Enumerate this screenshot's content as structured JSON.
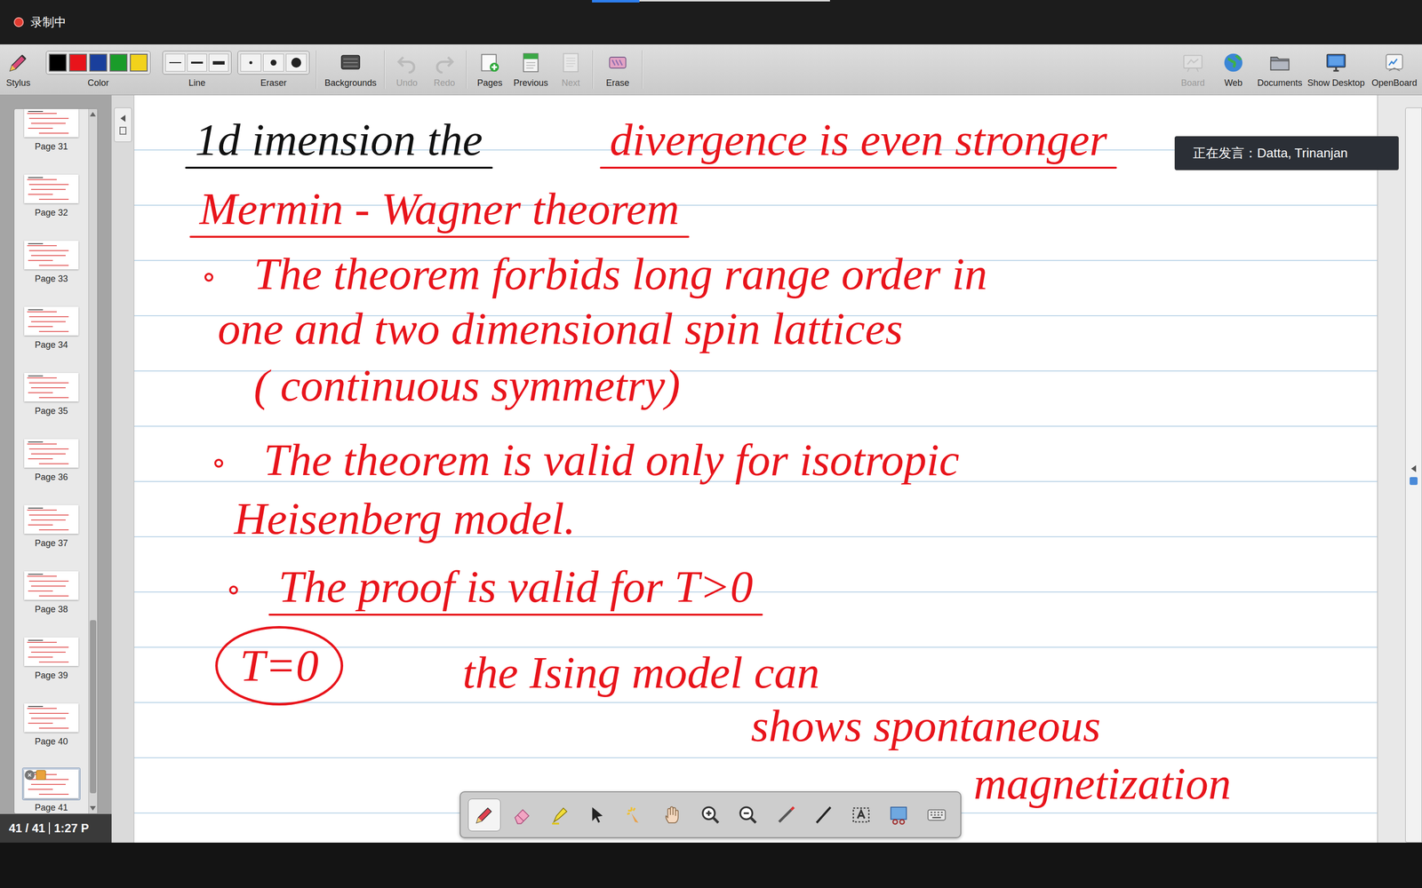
{
  "recording": {
    "label": "录制中"
  },
  "toolbar": {
    "left": [
      {
        "kind": "stylus",
        "label": "Stylus",
        "disabled": false
      },
      {
        "kind": "colors",
        "label": "Color",
        "disabled": false,
        "swatches": [
          {
            "color": "#000000"
          },
          {
            "color": "#e8141b"
          },
          {
            "color": "#1a3f9c"
          },
          {
            "color": "#1a9c2a"
          },
          {
            "color": "#f2d21b"
          }
        ]
      },
      {
        "kind": "lines",
        "label": "Line",
        "disabled": false
      },
      {
        "kind": "erasers",
        "label": "Eraser",
        "disabled": false
      },
      {
        "kind": "backgrounds",
        "label": "Backgrounds",
        "disabled": false
      },
      {
        "kind": "undo",
        "label": "Undo",
        "disabled": true
      },
      {
        "kind": "redo",
        "label": "Redo",
        "disabled": true
      },
      {
        "kind": "pages",
        "label": "Pages",
        "disabled": false
      },
      {
        "kind": "previous",
        "label": "Previous",
        "disabled": false
      },
      {
        "kind": "next",
        "label": "Next",
        "disabled": true
      },
      {
        "kind": "erase",
        "label": "Erase",
        "disabled": false
      }
    ],
    "right": [
      {
        "kind": "board",
        "label": "Board",
        "disabled": true
      },
      {
        "kind": "web",
        "label": "Web",
        "disabled": false
      },
      {
        "kind": "documents",
        "label": "Documents",
        "disabled": false
      },
      {
        "kind": "desktop",
        "label": "Show Desktop",
        "disabled": false
      },
      {
        "kind": "openboard",
        "label": "OpenBoard",
        "disabled": false
      }
    ]
  },
  "pages": {
    "items": [
      {
        "label": "Page 31",
        "selected": false
      },
      {
        "label": "Page 32",
        "selected": false
      },
      {
        "label": "Page 33",
        "selected": false
      },
      {
        "label": "Page 34",
        "selected": false
      },
      {
        "label": "Page 35",
        "selected": false
      },
      {
        "label": "Page 36",
        "selected": false
      },
      {
        "label": "Page 37",
        "selected": false
      },
      {
        "label": "Page 38",
        "selected": false
      },
      {
        "label": "Page 39",
        "selected": false
      },
      {
        "label": "Page 40",
        "selected": false
      },
      {
        "label": "Page 41",
        "selected": true
      }
    ],
    "counter": "41 / 41",
    "clock": "1:27 P"
  },
  "speaker": {
    "text": "正在发言：Datta, Trinanjan"
  },
  "board": {
    "items": [
      {
        "text": "1d imension the",
        "color": "#111111",
        "bullet": false,
        "underlined": true,
        "circled": false
      },
      {
        "text": "divergence is even stronger",
        "color": "#e8141b",
        "bullet": false,
        "underlined": true,
        "circled": false
      },
      {
        "text": "Mermin - Wagner theorem",
        "color": "#e8141b",
        "bullet": false,
        "underlined": true,
        "circled": false
      },
      {
        "text": "The theorem forbids long range order in",
        "color": "#e8141b",
        "bullet": true,
        "underlined": false,
        "circled": false
      },
      {
        "text": "one and two dimensional spin lattices",
        "color": "#e8141b",
        "bullet": false,
        "underlined": false,
        "circled": false
      },
      {
        "text": "( continuous symmetry)",
        "color": "#e8141b",
        "bullet": false,
        "underlined": false,
        "circled": false
      },
      {
        "text": "The theorem is valid only for isotropic",
        "color": "#e8141b",
        "bullet": true,
        "underlined": false,
        "circled": false
      },
      {
        "text": "Heisenberg model.",
        "color": "#e8141b",
        "bullet": false,
        "underlined": false,
        "circled": false
      },
      {
        "text": "The proof is valid for T>0",
        "color": "#e8141b",
        "bullet": true,
        "underlined": true,
        "circled": false
      },
      {
        "text": "T=0",
        "color": "#e8141b",
        "bullet": false,
        "underlined": false,
        "circled": true
      },
      {
        "text": "the Ising model can",
        "color": "#e8141b",
        "bullet": false,
        "underlined": false,
        "circled": false
      },
      {
        "text": "shows spontaneous",
        "color": "#e8141b",
        "bullet": false,
        "underlined": false,
        "circled": false
      },
      {
        "text": "magnetization",
        "color": "#e8141b",
        "bullet": false,
        "underlined": false,
        "circled": false
      }
    ]
  },
  "floating_tools": [
    {
      "kind": "pen",
      "selected": true
    },
    {
      "kind": "eraser",
      "selected": false
    },
    {
      "kind": "marker",
      "selected": false
    },
    {
      "kind": "pointer",
      "selected": false
    },
    {
      "kind": "laser",
      "selected": false
    },
    {
      "kind": "hand",
      "selected": false
    },
    {
      "kind": "zoomin",
      "selected": false
    },
    {
      "kind": "zoomout",
      "selected": false
    },
    {
      "kind": "stick",
      "selected": false
    },
    {
      "kind": "line",
      "selected": false
    },
    {
      "kind": "text",
      "selected": false
    },
    {
      "kind": "capture",
      "selected": false
    },
    {
      "kind": "keyboard",
      "selected": false
    }
  ]
}
